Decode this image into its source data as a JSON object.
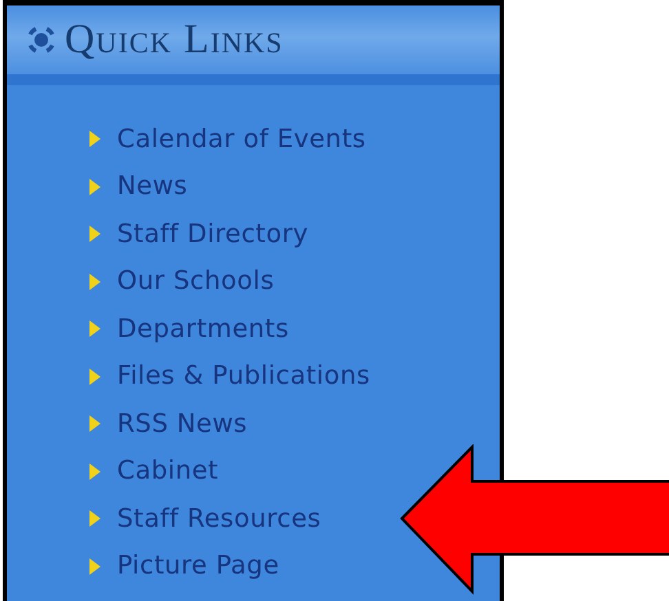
{
  "panel": {
    "title": "Quick Links"
  },
  "links": [
    {
      "label": "Calendar of Events"
    },
    {
      "label": "News"
    },
    {
      "label": "Staff Directory"
    },
    {
      "label": "Our Schools"
    },
    {
      "label": "Departments"
    },
    {
      "label": "Files & Publications"
    },
    {
      "label": "RSS News"
    },
    {
      "label": "Cabinet"
    },
    {
      "label": "Staff Resources"
    },
    {
      "label": "Picture Page"
    }
  ]
}
